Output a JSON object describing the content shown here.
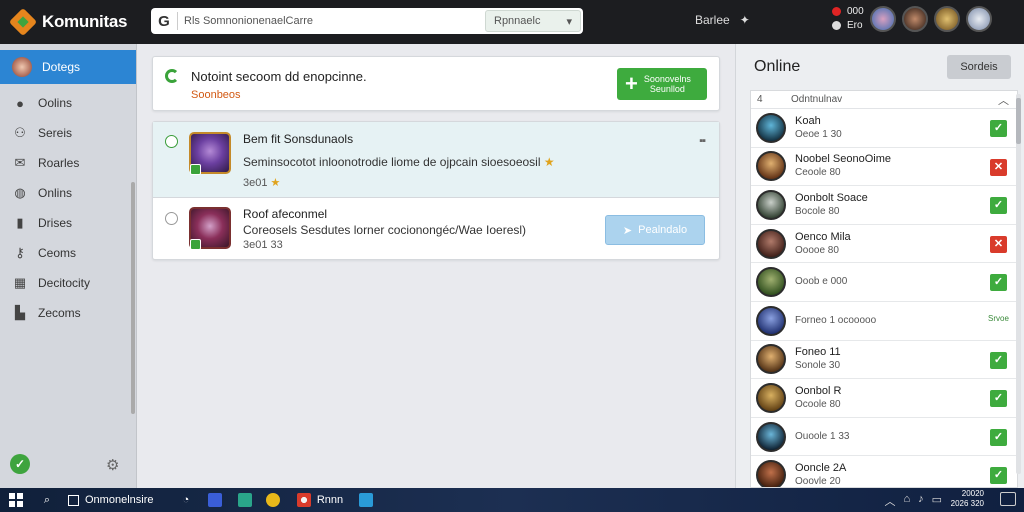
{
  "app": {
    "name": "Komunitas"
  },
  "search": {
    "icon": "G",
    "value": "Rls SomnonionenaelCarre",
    "select_label": "Rpnnaelc",
    "select_icon": "chevron-down"
  },
  "topbar": {
    "mid_label": "Barlee",
    "notif_line1": "000",
    "notif_line2": "Ero"
  },
  "sidebar": {
    "items": [
      {
        "label": "Dotegs",
        "icon": "avatar-icon",
        "active": true
      },
      {
        "label": "Oolins",
        "icon": "user-icon"
      },
      {
        "label": "Sereis",
        "icon": "users-icon"
      },
      {
        "label": "Roarles",
        "icon": "chat-icon"
      },
      {
        "label": "Onlins",
        "icon": "globe-icon"
      },
      {
        "label": "Drises",
        "icon": "book-icon"
      },
      {
        "label": "Ceoms",
        "icon": "key-icon"
      },
      {
        "label": "Decitocity",
        "icon": "grid-icon"
      },
      {
        "label": "Zecoms",
        "icon": "chart-icon"
      }
    ]
  },
  "notice": {
    "title": "Notoint secoom dd enopcinne.",
    "subtitle": "Soonbeos",
    "button_label": "Soonovelns\nSeunllod"
  },
  "posts": [
    {
      "title": "Bem fit Sonsdunaols",
      "body": "Seminsocotot inloonotrodie liome de ojpcain sioesoeosil",
      "meta": "3e01",
      "star": "★"
    },
    {
      "title": "Roof afeconmel",
      "body": "Coreosels Sesdutes lorner cocionongéc/Wae Ioeresl)",
      "meta": "3e01 33",
      "button_label": "Pealndalo"
    }
  ],
  "online": {
    "title": "Online",
    "button_label": "Sordeis",
    "header_num": "4",
    "header_label": "Odntnulnav",
    "people": [
      {
        "name": "Koah",
        "score": "Oeoe 1 30",
        "status": "ok",
        "colors": [
          "#5fb5d8",
          "#0f2a3a"
        ]
      },
      {
        "name": "Noobel SeonoOime",
        "score": "Ceoole 80",
        "status": "no",
        "colors": [
          "#e0b070",
          "#5a2a10"
        ]
      },
      {
        "name": "Oonbolt Soace",
        "score": "Bocole 80",
        "status": "ok",
        "colors": [
          "#c9cfc9",
          "#2a3a2a"
        ]
      },
      {
        "name": "Oenco Mila",
        "score": "Ooooe 80",
        "status": "no",
        "colors": [
          "#b07a6a",
          "#3a1a14"
        ]
      },
      {
        "name": "",
        "score": "Ooob e 000",
        "status": "ok",
        "colors": [
          "#a0b070",
          "#2a4a1a"
        ]
      },
      {
        "name": "",
        "score": "Forneo 1 ocooooo",
        "status": "tag",
        "tag": "Srvoe",
        "colors": [
          "#8aa0e0",
          "#1a2a6a"
        ]
      },
      {
        "name": "Foneo 11",
        "score": "Sonole 30",
        "status": "ok",
        "colors": [
          "#e0b070",
          "#4a2a10"
        ]
      },
      {
        "name": "Oonbol R",
        "score": "Ocoole 80",
        "status": "ok",
        "colors": [
          "#d8b060",
          "#5a3a10"
        ]
      },
      {
        "name": "",
        "score": "Ouoole 1 33",
        "status": "ok",
        "colors": [
          "#6ab5d8",
          "#0a1a2a"
        ]
      },
      {
        "name": "Ooncle 2A",
        "score": "Ooovle 20",
        "status": "ok",
        "colors": [
          "#c0704a",
          "#3a1a0a"
        ]
      }
    ]
  },
  "taskbar": {
    "search_label": "Onmonelnsire",
    "app_label": "Rnnn",
    "clock_line1": "20020",
    "clock_line2": "2026 320"
  },
  "colors": {
    "accent": "#2c85d3",
    "green": "#3eab3e",
    "red": "#d93b2b",
    "topbar": "#1c1d20"
  }
}
